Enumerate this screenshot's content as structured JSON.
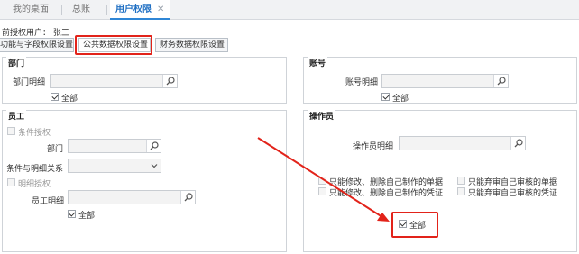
{
  "tabs": [
    "我的桌面",
    "总账",
    "用户权限"
  ],
  "owner": {
    "label": "前授权用户：",
    "value": "张三"
  },
  "subtabs": [
    "功能与字段权限设置",
    "公共数据权限设置",
    "财务数据权限设置"
  ],
  "dept": {
    "title": "部门",
    "detail_label": "部门明细",
    "all_label": "全部",
    "all_checked": true
  },
  "account": {
    "title": "账号",
    "detail_label": "账号明细",
    "all_label": "全部",
    "all_checked": true
  },
  "employee": {
    "title": "员工",
    "cond_auth": "条件授权",
    "dept_label": "部门",
    "relation_label": "条件与明细关系",
    "detail_auth": "明细授权",
    "emp_detail_label": "员工明细",
    "all_label": "全部",
    "all_checked": true
  },
  "operator": {
    "title": "操作员",
    "detail_label": "操作员明细",
    "options": [
      "只能修改、删除自己制作的单据",
      "只能弃审自己审核的单据",
      "只能修改、删除自己制作的凭证",
      "只能弃审自己审核的凭证"
    ],
    "all_label": "全部",
    "all_checked": true
  },
  "colors": {
    "highlight": "#e2231a",
    "active_tab": "#1f6fc3"
  },
  "icons": {
    "lookup": "search-icon",
    "dropdown": "chevron-down-icon",
    "tab_close": "close-icon"
  }
}
